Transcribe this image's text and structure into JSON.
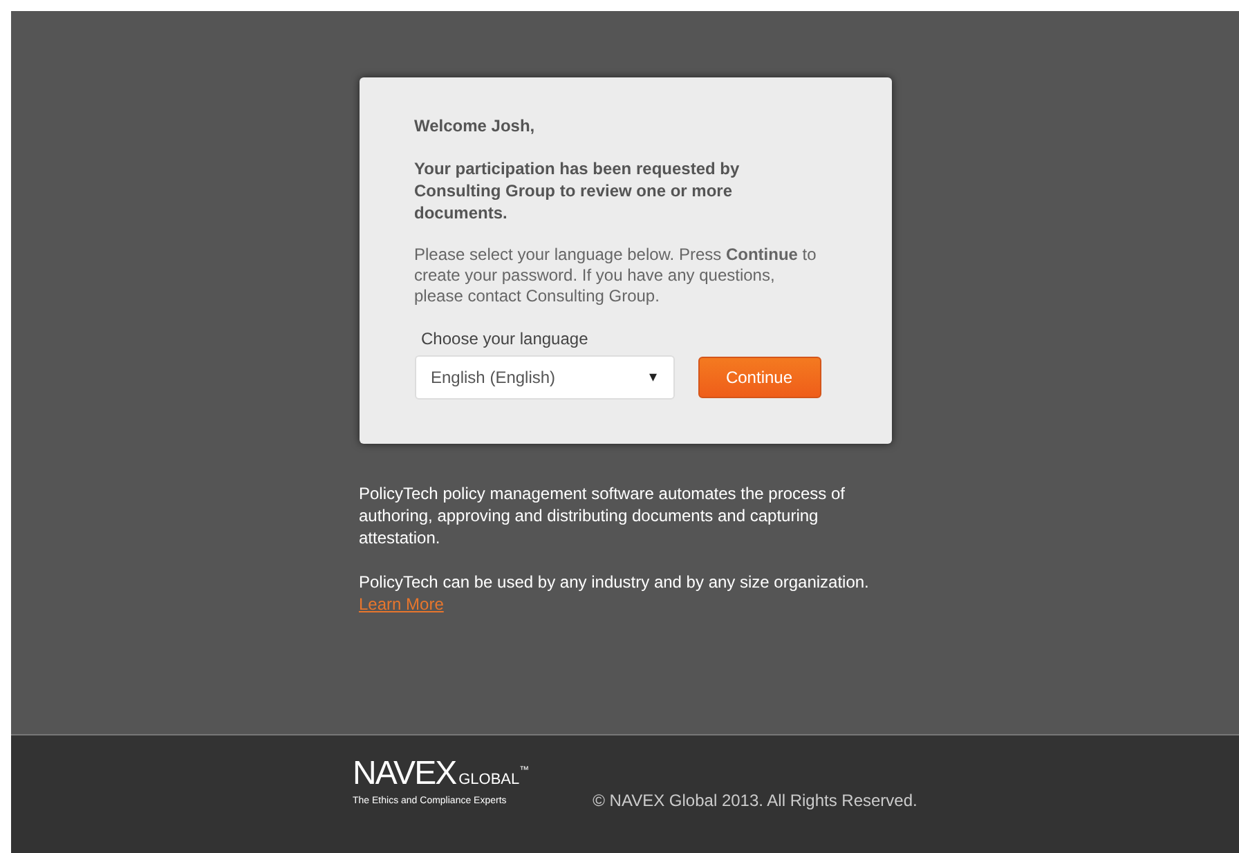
{
  "card": {
    "greeting": "Welcome Josh,",
    "request": "Your participation has been requested by Consulting Group to review one or more documents.",
    "instructions": "Please select your language below. Press **Continue** to create your password. If you have any questions, please contact Consulting Group.",
    "language_label": "Choose your language",
    "language_value": "English (English)",
    "dropdown_arrow": "▾",
    "continue_button": "Continue"
  },
  "info": {
    "paragraph_1": "PolicyTech policy management software automates the process of authoring, approving and distributing documents and capturing attestation.",
    "paragraph_2": "PolicyTech can be used by any industry and by any size organization.",
    "learn_more": "Learn More"
  },
  "footer": {
    "logo_main": "NAVEX",
    "logo_sub": "GLOBAL",
    "logo_tm": "™",
    "tagline": "The Ethics and Compliance Experts",
    "copyright": "© NAVEX Global 2013. All Rights Reserved."
  }
}
